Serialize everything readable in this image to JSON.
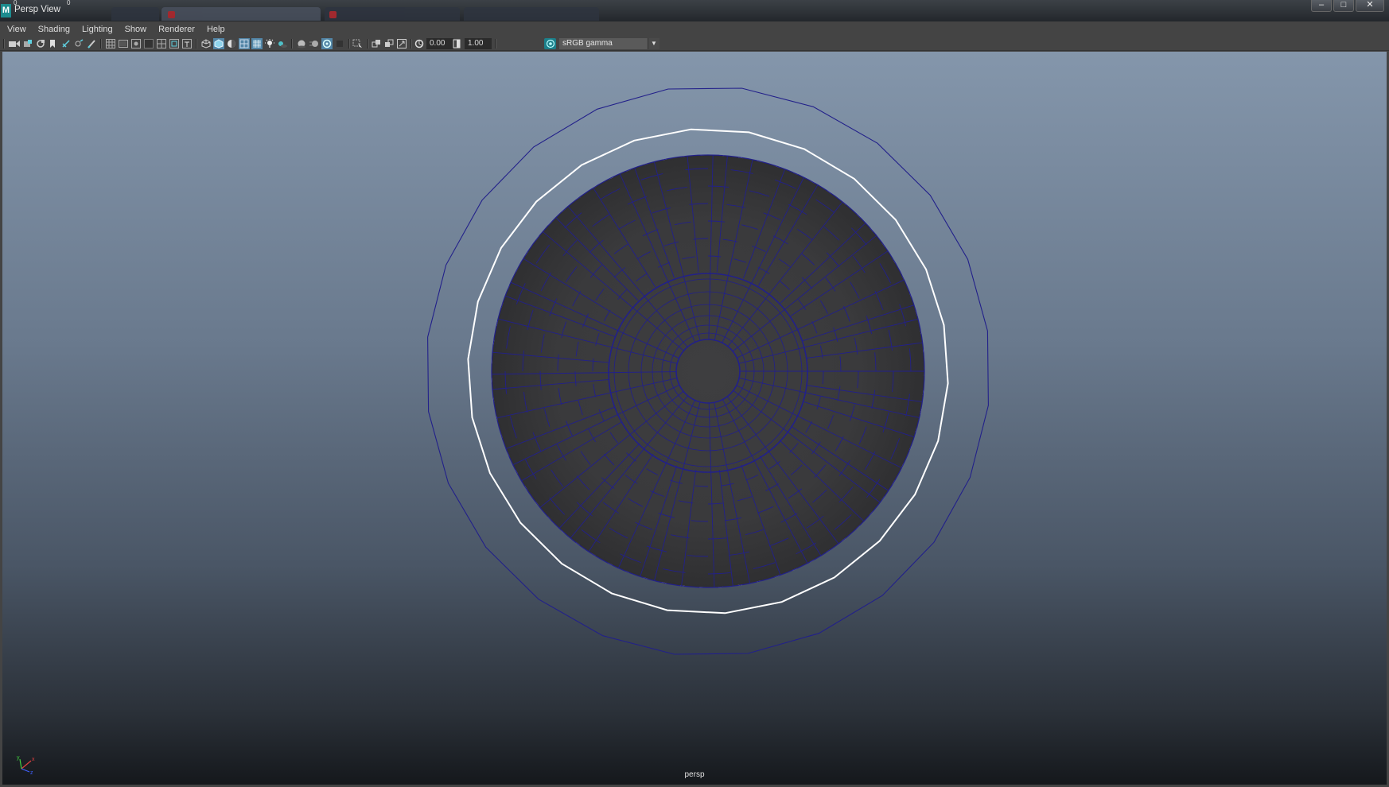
{
  "window": {
    "title": "Persp View",
    "logo_letter": "M",
    "marker_left": "0",
    "marker_right": "0"
  },
  "menubar": {
    "items": [
      "View",
      "Shading",
      "Lighting",
      "Show",
      "Renderer",
      "Help"
    ]
  },
  "toolbar": {
    "exposure_value": "0.00",
    "gamma_value": "1.00",
    "color_space": "sRGB gamma"
  },
  "viewport": {
    "camera_label": "persp",
    "axis": {
      "x": "x",
      "y": "y",
      "z": "z"
    }
  },
  "colors": {
    "accent": "#1d8c8f",
    "wireframe": "#22208a",
    "selection_outline": "#ffffff",
    "mesh_fill": "#3a3a3b"
  },
  "icons": [
    "camera-icon",
    "camera-attributes-icon",
    "bookmark-icon",
    "image-plane-icon",
    "2d-pan-icon",
    "grease-pencil-icon",
    "grid-icon",
    "film-gate-icon",
    "resolution-gate-icon",
    "gate-mask-icon",
    "field-chart-icon",
    "safe-action-icon",
    "safe-title-icon",
    "wireframe-icon",
    "smooth-shade-icon",
    "default-material-icon",
    "wireframe-on-shaded-icon",
    "xray-icon",
    "use-all-lights-icon",
    "shadows-icon",
    "ambient-occlusion-icon",
    "motion-blur-icon",
    "anti-aliasing-icon",
    "depth-of-field-icon",
    "isolate-select-icon",
    "xray-joints-icon",
    "xray-active-icon",
    "backface-culling-icon",
    "exposure-icon",
    "gamma-icon",
    "color-management-icon"
  ]
}
